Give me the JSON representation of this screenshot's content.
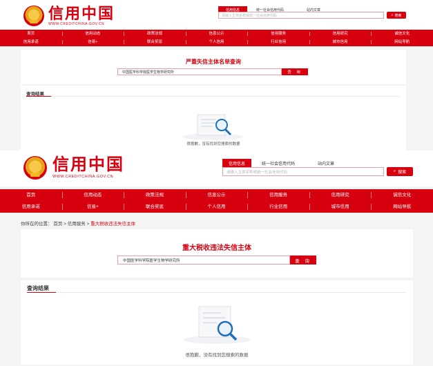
{
  "site": {
    "logo_text": "信用中国",
    "logo_url": "WWW.CREDITCHINA.GOV.CN"
  },
  "search": {
    "tabs": [
      "信用信息",
      "统一社会信用代码",
      "站内文章"
    ],
    "placeholder": "请输入主体名称或统一社会信用代码",
    "button_label": "搜索"
  },
  "nav": {
    "row1": [
      "首页",
      "信用动态",
      "政策法规",
      "信息公示",
      "信用服务",
      "信用研究",
      "诚信文化"
    ],
    "row2": [
      "信用承诺",
      "信易+",
      "联合奖惩",
      "个人信用",
      "行业信用",
      "城市信用",
      "网站导航"
    ]
  },
  "breadcrumb": {
    "prefix": "你所在的位置：",
    "home": "首页",
    "sep": ">",
    "service": "信用服务",
    "current": "重大税收违法失信主体"
  },
  "top_panel": {
    "title": "严重失信主体名单查询",
    "query_value": "中国医学科学院医学生物学研究所",
    "query_button": "查 询",
    "result_title": "查询结果",
    "empty_message": "很抱歉，没有找到您搜索的数据"
  },
  "bottom_panel": {
    "title": "重大税收违法失信主体",
    "query_value": "中国医学科学院医学生物学研究所",
    "query_button": "查 询",
    "result_title": "查询结果",
    "empty_message": "很抱歉，没有找到您搜索的数据"
  },
  "colors": {
    "brand_red": "#d6000f",
    "background": "#f4f4f4"
  },
  "icons": [
    "national-emblem-icon",
    "search-icon",
    "empty-result-illustration"
  ]
}
